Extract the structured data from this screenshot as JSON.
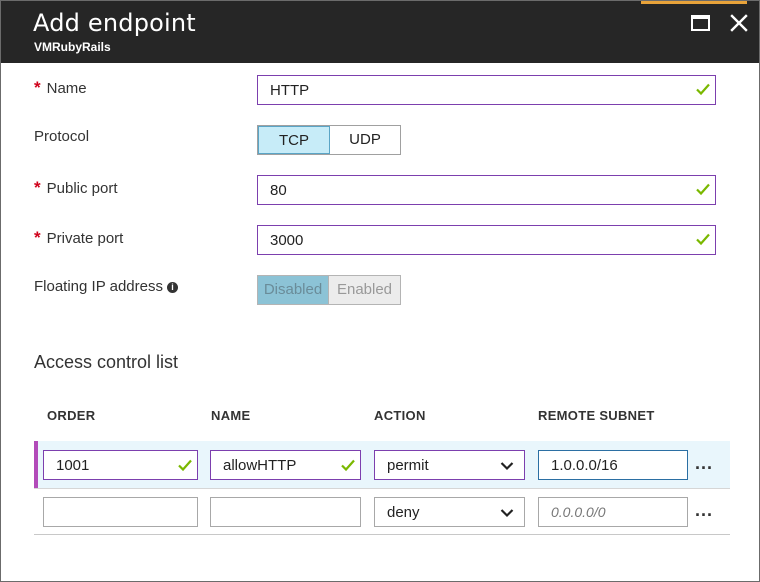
{
  "header": {
    "title": "Add endpoint",
    "subtitle": "VMRubyRails"
  },
  "form": {
    "name": {
      "label": "Name",
      "value": "HTTP"
    },
    "protocol": {
      "label": "Protocol",
      "options": [
        "TCP",
        "UDP"
      ],
      "selected": "TCP"
    },
    "public_port": {
      "label": "Public port",
      "value": "80"
    },
    "private_port": {
      "label": "Private port",
      "value": "3000"
    },
    "floating_ip": {
      "label": "Floating IP address",
      "options": [
        "Disabled",
        "Enabled"
      ],
      "selected": "Disabled"
    }
  },
  "acl": {
    "title": "Access control list",
    "columns": [
      "ORDER",
      "NAME",
      "ACTION",
      "REMOTE SUBNET"
    ],
    "rows": [
      {
        "order": "1001",
        "name": "allowHTTP",
        "action": "permit",
        "remote_subnet": "1.0.0.0/16",
        "more": "..."
      },
      {
        "order": "",
        "name": "",
        "action": "deny",
        "remote_subnet_placeholder": "0.0.0.0/0",
        "more": "..."
      }
    ]
  },
  "colors": {
    "header_bg": "#262626",
    "accent_bar": "#e8a33a",
    "required_star": "#d0021b",
    "valid_border": "#7c3fae",
    "valid_check": "#7ab800",
    "selected_toggle": "#c7ecf8",
    "selected_row": "#e9f6fc"
  }
}
